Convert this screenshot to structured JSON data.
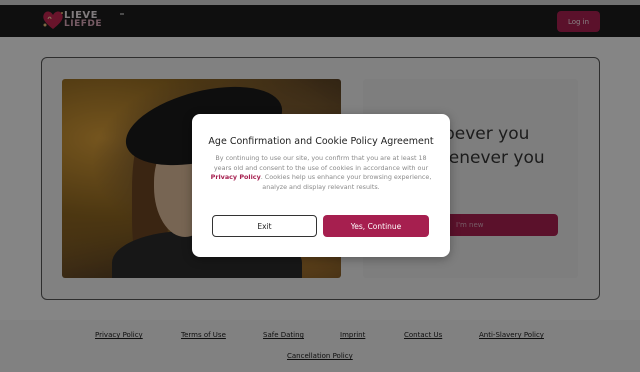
{
  "header": {
    "logo": {
      "line1": "LIEVE",
      "line2": "LIEFDE",
      "icon": "heart-logo-icon"
    },
    "login_label": "Log in"
  },
  "hero": {
    "headline_line1": "bever you",
    "headline_line2": "henever you",
    "new_button_label": "I'm new"
  },
  "modal": {
    "title": "Age Confirmation and Cookie Policy Agreement",
    "body_before_link": "By continuing to use our site, you confirm that you are at least 18 years old and consent to the use of cookies in accordance with our ",
    "link_text": "Privacy Policy",
    "body_after_link": ". Cookies help us enhance your browsing experience, analyze and display relevant results.",
    "exit_label": "Exit",
    "continue_label": "Yes, Continue"
  },
  "footer": {
    "links": [
      "Privacy Policy",
      "Terms of Use",
      "Safe Dating",
      "Imprint",
      "Contact Us",
      "Anti-Slavery Policy",
      "Cancellation Policy"
    ]
  },
  "colors": {
    "accent": "#a61f4f",
    "header_bg": "#1c1c1c",
    "page_bg": "#f2f2f2"
  }
}
